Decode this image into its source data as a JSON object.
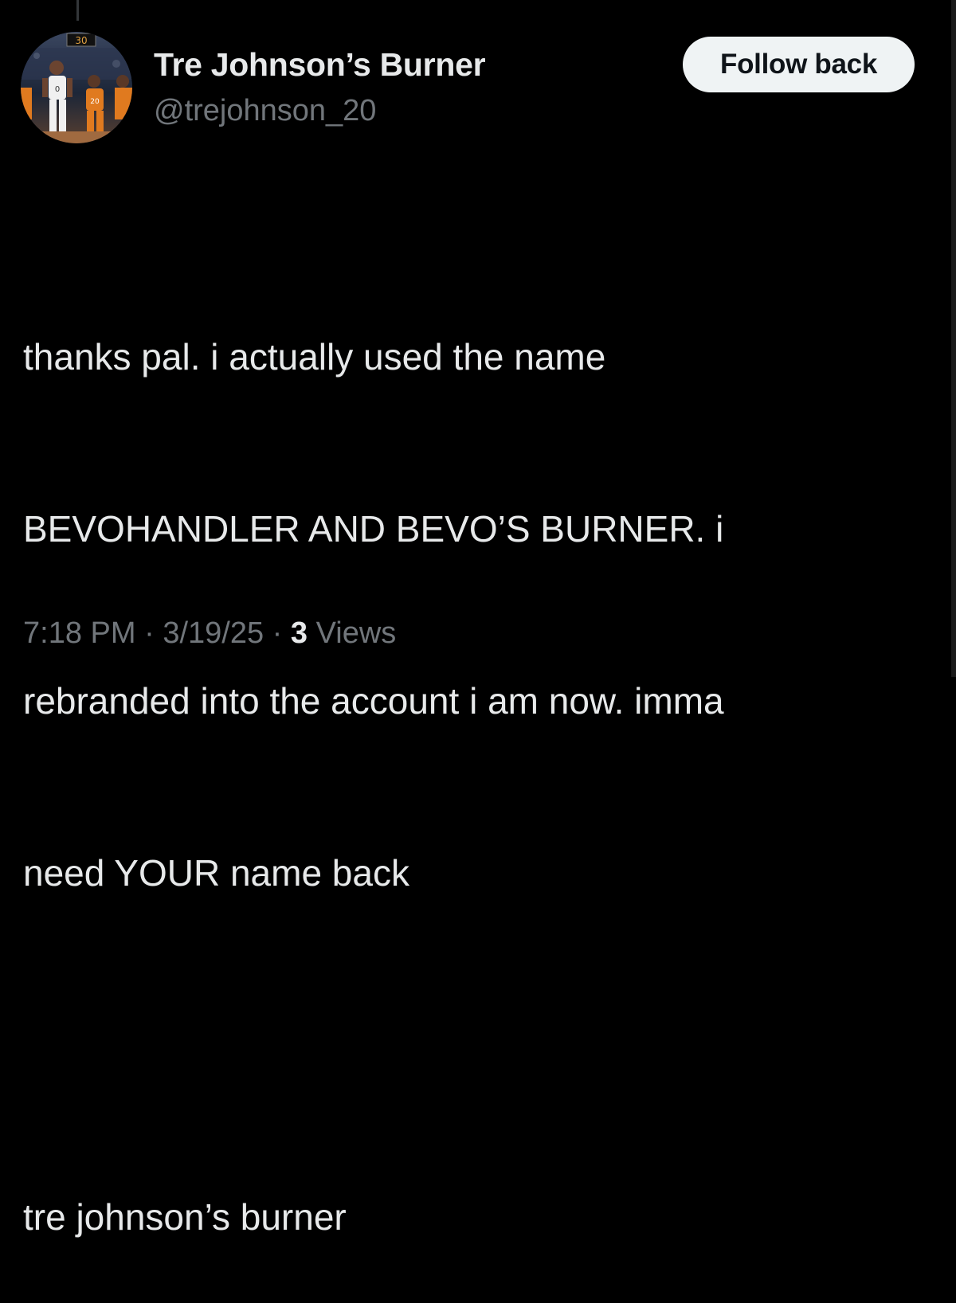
{
  "author": {
    "display_name": "Tre Johnson’s Burner",
    "handle": "@trejohnson_20",
    "avatar_icon": "basketball-players-photo",
    "avatar_scoreboard": "30"
  },
  "actions": {
    "follow_label": "Follow back"
  },
  "tweet": {
    "lines": [
      "thanks pal. i actually used the name",
      "BEVOHANDLER AND BEVO’S BURNER. i",
      "rebranded into the account i am now. imma",
      "need YOUR name back"
    ],
    "signature": "tre johnson’s burner"
  },
  "meta": {
    "time": "7:18 PM",
    "separator": " · ",
    "date": "3/19/25",
    "views_count": "3",
    "views_label": " Views"
  },
  "colors": {
    "background": "#000000",
    "primary_text": "#e7e9ea",
    "secondary_text": "#71767b",
    "button_bg": "#eff3f4",
    "button_text": "#0f1419"
  }
}
